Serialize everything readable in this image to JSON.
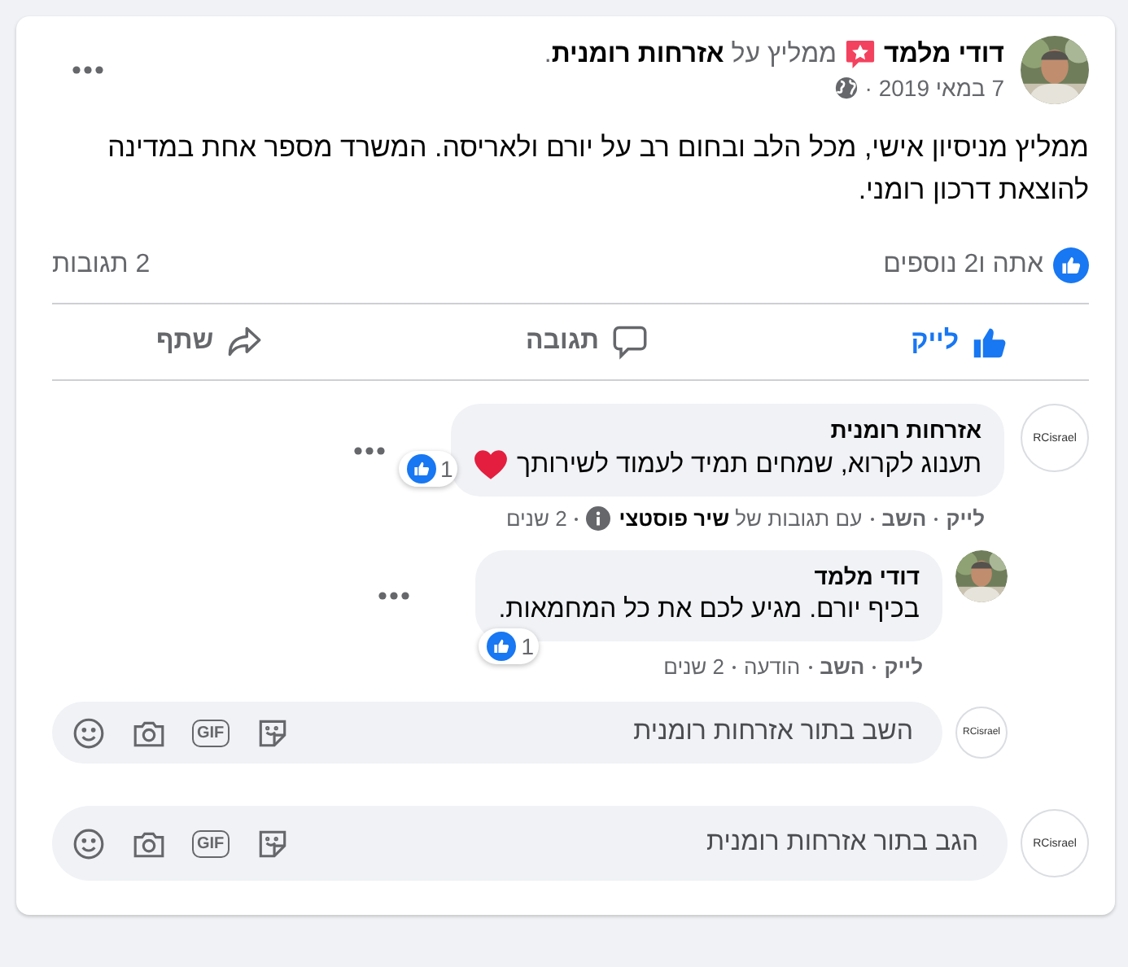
{
  "post": {
    "author": "דודי מלמד",
    "recommendation": "ממליץ על **אזרחות רומנית**.",
    "date": "7 במאי 2019 ·",
    "text": "ממליץ מניסיון אישי, מכל הלב ובחום רב על יורם ולאריסה. המשרד מספר אחת במדינה להוצאת דרכון רומני."
  },
  "summary": {
    "reactions": "אתה ו2 נוספים",
    "comments": "2 תגובות"
  },
  "actions": [
    {
      "kind": "like",
      "label": "לייק",
      "selected": true
    },
    {
      "kind": "comment",
      "label": "תגובה",
      "selected": false
    },
    {
      "kind": "share",
      "label": "שתף",
      "selected": false
    }
  ],
  "comments": [
    {
      "author": "אזרחות רומנית",
      "avatar": {
        "kind": "logo",
        "text": "RCisrael"
      },
      "text": "תענוג לקרוא, שמחים תמיד לעמוד לשירותך",
      "heart": true,
      "reactions": "1",
      "meta": [
        {
          "kind": "action",
          "text": "לייק"
        },
        {
          "kind": "action",
          "text": "השב"
        },
        {
          "kind": "note",
          "text": "עם תגובות של **שיר פוסטצי**",
          "info_icon": true
        },
        {
          "kind": "time",
          "text": "2 שנים"
        }
      ],
      "children": [
        {
          "author": "דודי מלמד",
          "text": "בכיף יורם. מגיע לכם את כל המחמאות.",
          "reactions": "1",
          "meta": [
            {
              "kind": "action",
              "text": "לייק"
            },
            {
              "kind": "action",
              "text": "השב"
            },
            {
              "kind": "note",
              "text": "הודעה"
            },
            {
              "kind": "time",
              "text": "2 שנים"
            }
          ]
        }
      ],
      "reply_field": {
        "placeholder": "השב בתור אזרחות רומנית",
        "avatar": {
          "kind": "logo",
          "text": "RCisrael"
        },
        "gif_label": "GIF"
      }
    }
  ],
  "comment_field": {
    "placeholder": "הגב בתור אזרחות רומנית",
    "avatar": {
      "kind": "logo",
      "text": "RCisrael"
    },
    "gif_label": "GIF"
  }
}
